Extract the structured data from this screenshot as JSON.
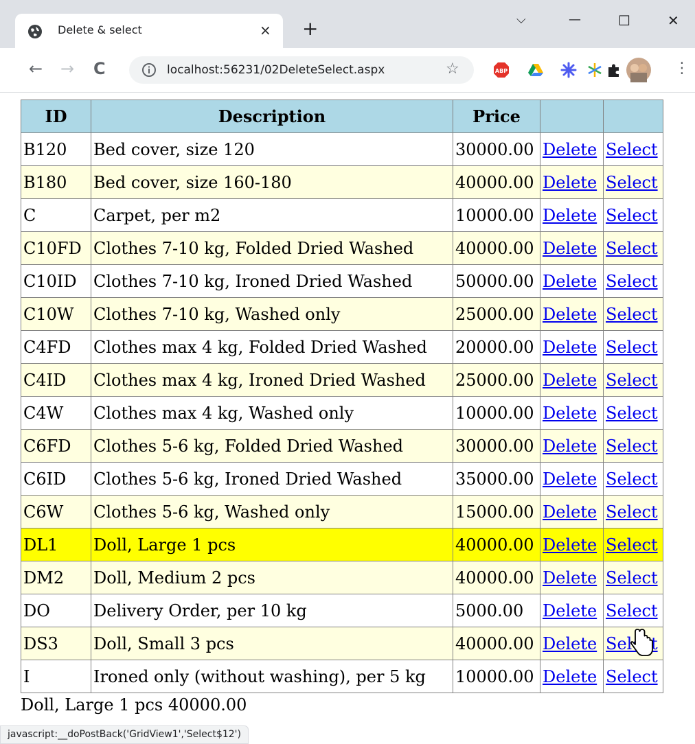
{
  "browser": {
    "tab_title": "Delete & select",
    "tab_close": "×",
    "new_tab": "+",
    "url": "localhost:56231/02DeleteSelect.aspx",
    "controls": {
      "dropdown": "⌵",
      "minimize": "—",
      "maximize": "☐",
      "close": "✕"
    },
    "nav": {
      "back": "←",
      "forward": "→",
      "reload": "C"
    },
    "bookmark_star": "☆",
    "menu": "⋮",
    "extensions": [
      "adblock-plus-icon",
      "google-drive-icon",
      "extension-asterisk-icon",
      "snowflake-extension-icon",
      "extensions-puzzle-icon",
      "profile-avatar"
    ]
  },
  "grid": {
    "headers": [
      "ID",
      "Description",
      "Price",
      "",
      ""
    ],
    "delete_label": "Delete",
    "select_label": "Select",
    "selected_index": 12,
    "colors": {
      "header": "#add8e6",
      "alt_row": "#ffffe0",
      "selected_row": "#ffff00",
      "link": "#0000ee"
    },
    "rows": [
      {
        "id": "B120",
        "description": "Bed cover, size 120",
        "price": "30000.00"
      },
      {
        "id": "B180",
        "description": "Bed cover, size 160-180",
        "price": "40000.00"
      },
      {
        "id": "C",
        "description": "Carpet, per m2",
        "price": "10000.00"
      },
      {
        "id": "C10FD",
        "description": "Clothes 7-10 kg, Folded Dried Washed",
        "price": "40000.00"
      },
      {
        "id": "C10ID",
        "description": "Clothes 7-10 kg, Ironed Dried Washed",
        "price": "50000.00"
      },
      {
        "id": "C10W",
        "description": "Clothes 7-10 kg, Washed only",
        "price": "25000.00"
      },
      {
        "id": "C4FD",
        "description": "Clothes max 4 kg, Folded Dried Washed",
        "price": "20000.00"
      },
      {
        "id": "C4ID",
        "description": "Clothes max 4 kg, Ironed Dried Washed",
        "price": "25000.00"
      },
      {
        "id": "C4W",
        "description": "Clothes max 4 kg, Washed only",
        "price": "10000.00"
      },
      {
        "id": "C6FD",
        "description": "Clothes 5-6 kg, Folded Dried Washed",
        "price": "30000.00"
      },
      {
        "id": "C6ID",
        "description": "Clothes 5-6 kg, Ironed Dried Washed",
        "price": "35000.00"
      },
      {
        "id": "C6W",
        "description": "Clothes 5-6 kg, Washed only",
        "price": "15000.00"
      },
      {
        "id": "DL1",
        "description": "Doll, Large 1 pcs",
        "price": "40000.00"
      },
      {
        "id": "DM2",
        "description": "Doll, Medium 2 pcs",
        "price": "40000.00"
      },
      {
        "id": "DO",
        "description": "Delivery Order, per 10 kg",
        "price": "5000.00"
      },
      {
        "id": "DS3",
        "description": "Doll, Small 3 pcs",
        "price": "40000.00"
      },
      {
        "id": "I",
        "description": "Ironed only (without washing), per 5 kg",
        "price": "10000.00"
      }
    ]
  },
  "summary": "Doll, Large 1 pcs 40000.00",
  "status": "javascript:__doPostBack('GridView1','Select$12')"
}
